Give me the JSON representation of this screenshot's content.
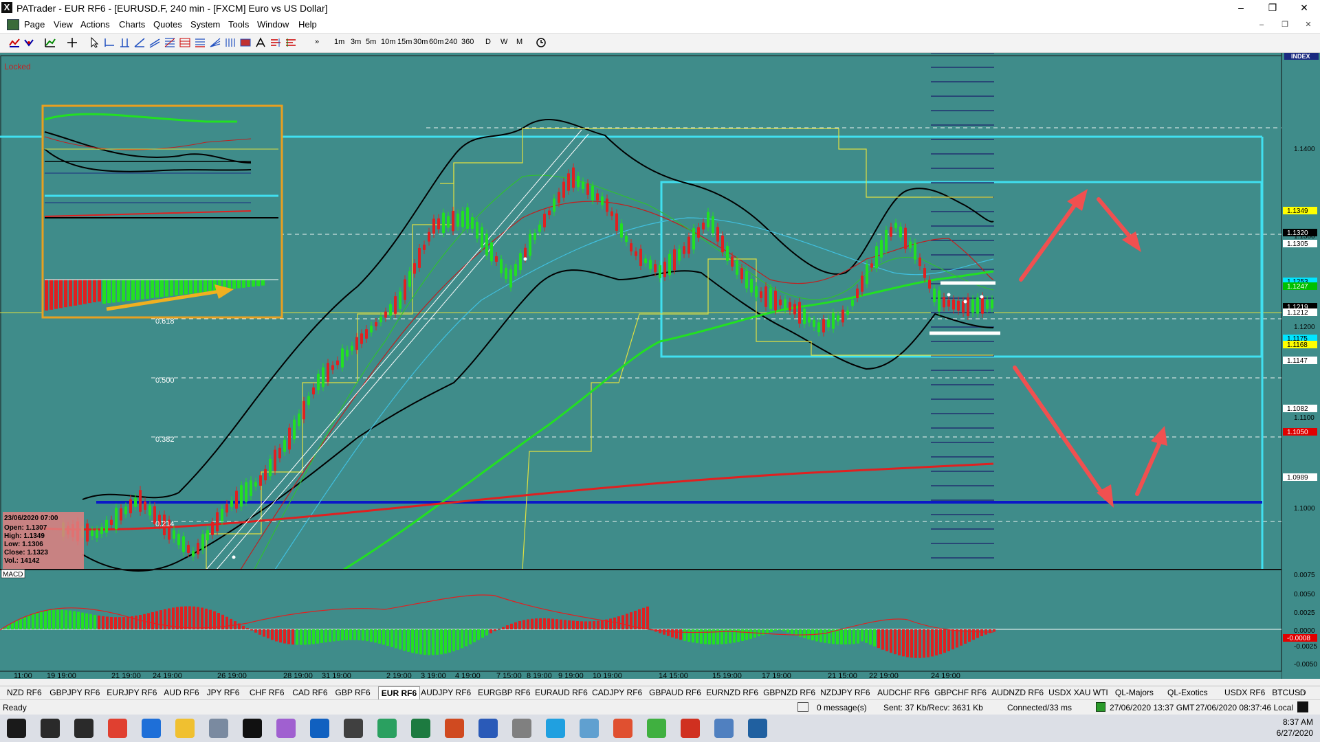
{
  "window": {
    "title": "PATrader - EUR RF6 - [EURUSD.F, 240 min - [FXCM] Euro vs US Dollar]",
    "logo": "X",
    "controls": {
      "minimize": "–",
      "maximize": "❐",
      "close": "✕"
    },
    "mdi_controls": {
      "minimize": "–",
      "restore": "❐",
      "close": "✕"
    }
  },
  "menu": [
    "Page",
    "View",
    "Actions",
    "Charts",
    "Quotes",
    "System",
    "Tools",
    "Window",
    "Help"
  ],
  "toolbar": {
    "timeframes": [
      "1m",
      "3m",
      "5m",
      "10m",
      "15m",
      "30m",
      "60m",
      "240",
      "360"
    ],
    "periods": [
      "D",
      "W",
      "M"
    ]
  },
  "chart": {
    "locked_label": "Locked",
    "index_label": "INDEX",
    "fib_labels": [
      "0.618",
      "0.500",
      "0.382",
      "0.214"
    ],
    "price_ticks": [
      "1.1400",
      "1.1300",
      "1.1200",
      "1.1100",
      "1.1000"
    ],
    "price_flags": [
      {
        "text": "1.1349",
        "bg": "#ffff00",
        "fg": "#000"
      },
      {
        "text": "1.1320",
        "bg": "#000000",
        "fg": "#fff"
      },
      {
        "text": "1.1305",
        "bg": "#ffffff",
        "fg": "#000"
      },
      {
        "text": "1.1253",
        "bg": "#00e5ff",
        "fg": "#000"
      },
      {
        "text": "1.1247",
        "bg": "#00c000",
        "fg": "#fff"
      },
      {
        "text": "1.1219",
        "bg": "#000000",
        "fg": "#fff"
      },
      {
        "text": "1.1212",
        "bg": "#ffffff",
        "fg": "#000"
      },
      {
        "text": "1.1175",
        "bg": "#00e5ff",
        "fg": "#000"
      },
      {
        "text": "1.1168",
        "bg": "#ffff00",
        "fg": "#000"
      },
      {
        "text": "1.1147",
        "bg": "#ffffff",
        "fg": "#000"
      },
      {
        "text": "1.1082",
        "bg": "#ffffff",
        "fg": "#000"
      },
      {
        "text": "1.1050",
        "bg": "#e00000",
        "fg": "#fff"
      },
      {
        "text": "1.0989",
        "bg": "#ffffff",
        "fg": "#000"
      }
    ],
    "info_box": {
      "date": "23/06/2020 07:00",
      "open": "Open: 1.1307",
      "high": "High: 1.1349",
      "low": "Low: 1.1306",
      "close": "Close: 1.1323",
      "vol": "Vol.: 14142"
    },
    "macd_label": "MACD",
    "macd_ticks": [
      "0.0075",
      "0.0050",
      "0.0025",
      "0.0000",
      "-0.0025",
      "-0.0050"
    ],
    "macd_flag": "-0.0008",
    "time_labels": [
      "11:00",
      "19 19:00",
      "21 19:00",
      "24 19:00",
      "26 19:00",
      "28 19:00",
      "31 19:00",
      "2 19:00",
      "3 19:00",
      "4 19:00",
      "7 15:00",
      "8 19:00",
      "9 19:00",
      "10 19:00",
      "14 15:00",
      "15 19:00",
      "17 19:00",
      "21 15:00",
      "22 19:00",
      "24 19:00"
    ]
  },
  "tabs": [
    "NZD RF6",
    "GBPJPY RF6",
    "EURJPY RF6",
    "AUD RF6",
    "JPY RF6",
    "CHF RF6",
    "CAD RF6",
    "GBP RF6",
    "EUR RF6",
    "AUDJPY RF6",
    "EURGBP RF6",
    "EURAUD RF6",
    "CADJPY RF6",
    "GBPAUD RF6",
    "EURNZD RF6",
    "GBPNZD RF6",
    "NZDJPY RF6",
    "AUDCHF RF6",
    "GBPCHF RF6",
    "AUDNZD RF6",
    "USDX XAU WTI",
    "QL-Majors",
    "QL-Exotics",
    "USDX RF6",
    "BTCUSD"
  ],
  "active_tab": "EUR RF6",
  "status": {
    "ready": "Ready",
    "messages": "0 message(s)",
    "traffic": "Sent: 37 Kb/Recv: 3631 Kb",
    "connection": "Connected/33 ms",
    "gmt": "27/06/2020 13:37 GMT",
    "local": "27/06/2020 08:37:46 Local"
  },
  "taskbar": {
    "time": "8:37 AM",
    "date": "6/27/2020",
    "icons": [
      "start-icon",
      "search-icon",
      "taskview-icon",
      "chrome-icon",
      "edge-icon",
      "explorer-icon",
      "app-icon",
      "patrader-icon",
      "app2-icon",
      "outlook-icon",
      "calculator-icon",
      "spreadsheet-icon",
      "excel-icon",
      "powerpoint-icon",
      "word-icon",
      "app3-icon",
      "app4-icon",
      "app5-icon",
      "app6-icon",
      "app7-icon",
      "app8-icon",
      "app9-icon",
      "app10-icon"
    ]
  },
  "colors": {
    "chart_bg": "#3f8c8a",
    "bull": "#22e022",
    "bear": "#e02020",
    "cyan": "#40e0f0"
  }
}
